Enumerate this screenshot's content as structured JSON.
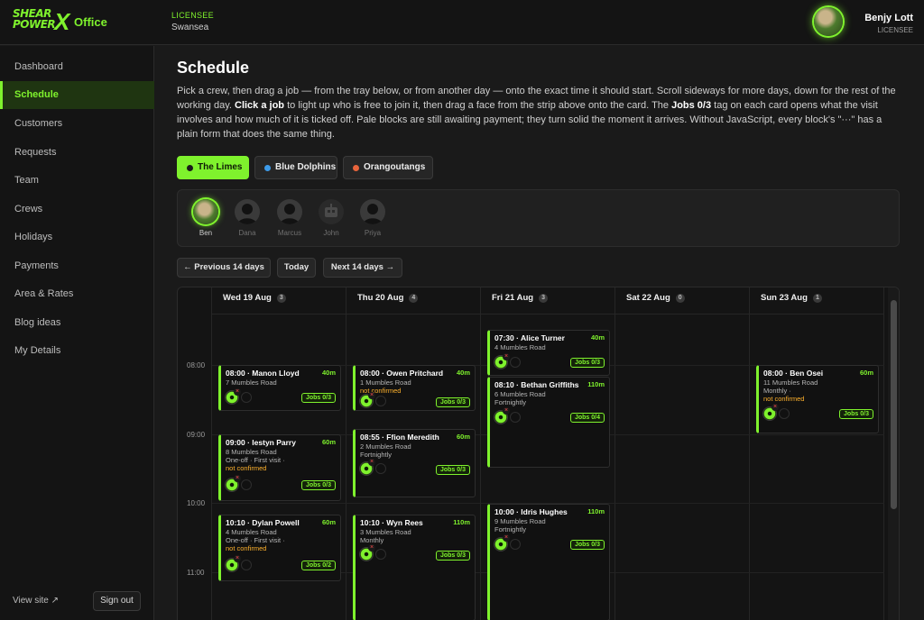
{
  "brand": {
    "line1": "SHEAR",
    "line2": "POWER",
    "mark": "X",
    "app": "Office",
    "accent_color": "#7ff22d"
  },
  "licensee": {
    "label": "LICENSEE",
    "city": "Swansea"
  },
  "user": {
    "name": "Benjy Lott",
    "role": "LICENSEE",
    "avatar_icon": "user-photo"
  },
  "sidebar": {
    "items": [
      {
        "label": "Dashboard",
        "active": false
      },
      {
        "label": "Schedule",
        "active": true
      },
      {
        "label": "Customers",
        "active": false
      },
      {
        "label": "Requests",
        "active": false
      },
      {
        "label": "Team",
        "active": false
      },
      {
        "label": "Crews",
        "active": false
      },
      {
        "label": "Holidays",
        "active": false
      },
      {
        "label": "Payments",
        "active": false
      },
      {
        "label": "Area & Rates",
        "active": false
      },
      {
        "label": "Blog ideas",
        "active": false
      },
      {
        "label": "My Details",
        "active": false
      }
    ],
    "view_site": "View site ↗",
    "sign_out": "Sign out"
  },
  "page": {
    "title": "Schedule",
    "intro": {
      "p1": "Pick a crew, then drag a job — from the tray below, or from another day — onto the exact time it should start. Scroll sideways for more days, down for the rest of the working day. ",
      "b1": "Click a job",
      "p2": " to light up who is free to join it, then drag a face from the strip above onto the card. The ",
      "b2": "Jobs 0/3",
      "p3": " tag on each card opens what the visit involves and how much of it is ticked off. Pale blocks are still awaiting payment; they turn solid the moment it arrives. Without JavaScript, every block's \"···\" has a plain form that does the same thing."
    }
  },
  "crews": [
    {
      "label": "The Limes",
      "color": "#1a1a1a",
      "active": true
    },
    {
      "label": "Blue Dolphins",
      "color": "#3d9be9",
      "active": false
    },
    {
      "label": "Orangoutangs",
      "color": "#e8643c",
      "active": false
    }
  ],
  "faces": [
    {
      "name": "Ben",
      "active": true
    },
    {
      "name": "Dana",
      "active": false
    },
    {
      "name": "Marcus",
      "active": false
    },
    {
      "name": "John",
      "active": false
    },
    {
      "name": "Priya",
      "active": false
    }
  ],
  "range": {
    "prev": "← Previous 14 days",
    "today": "Today",
    "next": "Next 14 days →"
  },
  "times": [
    "08:00",
    "09:00",
    "10:00",
    "11:00"
  ],
  "days": [
    {
      "label": "Wed 19 Aug",
      "count": "3",
      "jobs": [
        {
          "time_title": "08:00 · Manon Lloyd",
          "duration": "40m",
          "address": "7 Mumbles Road",
          "freq": "",
          "warn": "",
          "tag": "Jobs 0/3"
        },
        {
          "time_title": "09:00 · Iestyn Parry",
          "duration": "60m",
          "address": "8 Mumbles Road",
          "freq": "One-off · First visit ·",
          "warn": "not confirmed",
          "tag": "Jobs 0/3"
        },
        {
          "time_title": "10:10 · Dylan Powell",
          "duration": "60m",
          "address": "4 Mumbles Road",
          "freq": "One-off · First visit ·",
          "warn": "not confirmed",
          "tag": "Jobs 0/2"
        }
      ]
    },
    {
      "label": "Thu 20 Aug",
      "count": "4",
      "jobs": [
        {
          "time_title": "08:00 · Owen Pritchard",
          "duration": "40m",
          "address": "1 Mumbles Road",
          "freq": "",
          "warn": "not confirmed",
          "tag": "Jobs 0/3"
        },
        {
          "time_title": "08:55 · Ffion Meredith",
          "duration": "60m",
          "address": "2 Mumbles Road",
          "freq": "Fortnightly",
          "warn": "",
          "tag": "Jobs 0/3"
        },
        {
          "time_title": "10:10 · Wyn Rees",
          "duration": "110m",
          "address": "3 Mumbles Road",
          "freq": "Monthly",
          "warn": "",
          "tag": "Jobs 0/3"
        }
      ]
    },
    {
      "label": "Fri 21 Aug",
      "count": "3",
      "jobs": [
        {
          "time_title": "07:30 · Alice Turner",
          "duration": "40m",
          "address": "4 Mumbles Road",
          "freq": "",
          "warn": "",
          "tag": "Jobs 0/3"
        },
        {
          "time_title": "08:10 · Bethan Griffiths",
          "duration": "110m",
          "address": "6 Mumbles Road",
          "freq": "Fortnightly",
          "warn": "",
          "tag": "Jobs 0/4"
        },
        {
          "time_title": "10:00 · Idris Hughes",
          "duration": "110m",
          "address": "9 Mumbles Road",
          "freq": "Fortnightly",
          "warn": "",
          "tag": "Jobs 0/3"
        }
      ]
    },
    {
      "label": "Sat 22 Aug",
      "count": "0",
      "jobs": []
    },
    {
      "label": "Sun 23 Aug",
      "count": "1",
      "jobs": [
        {
          "time_title": "08:00 · Ben Osei",
          "duration": "60m",
          "address": "11 Mumbles Road",
          "freq": "Monthly ·",
          "warn": "not confirmed",
          "tag": "Jobs 0/3"
        }
      ]
    }
  ]
}
